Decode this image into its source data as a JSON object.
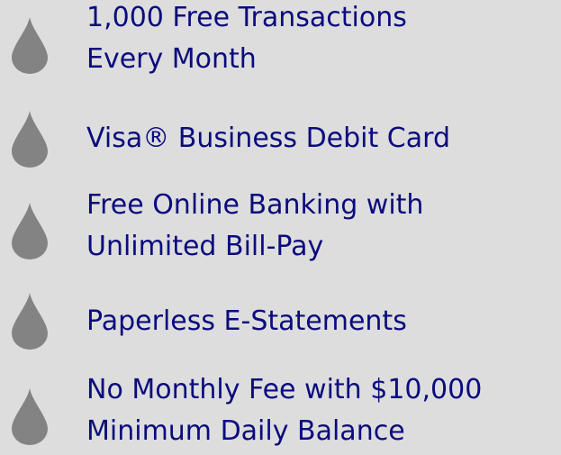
{
  "features": [
    {
      "lines": [
        "1,000 Free Transactions",
        "Every Month"
      ]
    },
    {
      "lines": [
        "Visa® Business Debit Card"
      ]
    },
    {
      "lines": [
        "Free Online Banking with",
        "Unlimited Bill-Pay"
      ]
    },
    {
      "lines": [
        "Paperless E-Statements"
      ]
    },
    {
      "lines": [
        "No Monthly Fee with $10,000",
        "Minimum Daily Balance"
      ]
    }
  ],
  "colors": {
    "background": "#dddddd",
    "text": "#0b0b7e",
    "bullet": "#838383"
  },
  "icons": {
    "bullet": "water-drop-icon"
  }
}
